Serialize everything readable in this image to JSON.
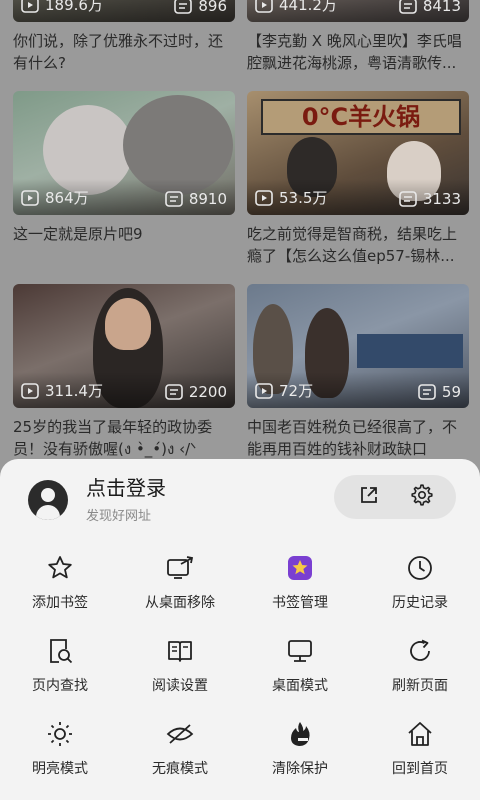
{
  "feed": {
    "cards": [
      {
        "plays": "189.6万",
        "comments": "896",
        "title": "你们说，除了优雅永不过时，还有什么?"
      },
      {
        "plays": "441.2万",
        "comments": "8413",
        "title": "【李克勤 X 晚风心里吹】李氏唱腔飘进花海桃源，粤语清歌传..."
      },
      {
        "plays": "864万",
        "comments": "8910",
        "title": "这一定就是原片吧9"
      },
      {
        "plays": "53.5万",
        "comments": "3133",
        "title": "吃之前觉得是智商税，结果吃上瘾了【怎么这么值ep57-锡林...",
        "poster": "0°C羊火锅"
      },
      {
        "plays": "311.4万",
        "comments": "2200",
        "title": "25岁的我当了最年轻的政协委员！没有骄傲喔(ง •̀_•́)ง ‹/ᐠ"
      },
      {
        "plays": "72万",
        "comments": "59",
        "title": "中国老百姓税负已经很高了，不能再用百姓的钱补财政缺口"
      }
    ]
  },
  "sheet": {
    "login_title": "点击登录",
    "login_subtitle": "发现好网址",
    "actions": [
      {
        "label": "添加书签",
        "icon": "star-icon"
      },
      {
        "label": "从桌面移除",
        "icon": "desktop-remove-icon"
      },
      {
        "label": "书签管理",
        "icon": "bookmark-manager-icon"
      },
      {
        "label": "历史记录",
        "icon": "clock-icon"
      },
      {
        "label": "页内查找",
        "icon": "find-in-page-icon"
      },
      {
        "label": "阅读设置",
        "icon": "book-icon"
      },
      {
        "label": "桌面模式",
        "icon": "monitor-icon"
      },
      {
        "label": "刷新页面",
        "icon": "refresh-icon"
      },
      {
        "label": "明亮模式",
        "icon": "sun-icon"
      },
      {
        "label": "无痕模式",
        "icon": "incognito-icon"
      },
      {
        "label": "清除保护",
        "icon": "fire-icon"
      },
      {
        "label": "回到首页",
        "icon": "home-icon"
      }
    ]
  }
}
